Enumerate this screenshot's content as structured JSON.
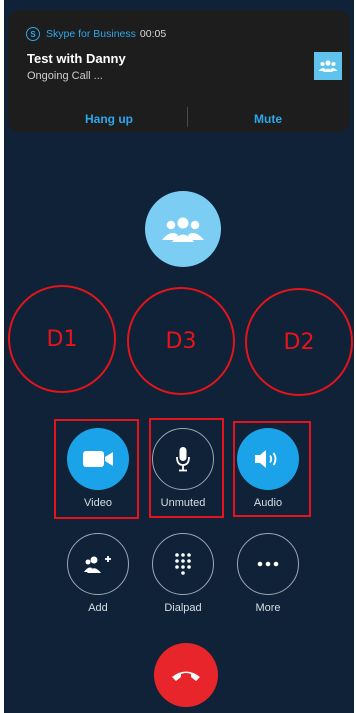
{
  "notification": {
    "app_name": "Skype for Business",
    "app_icon": "skype-icon",
    "time": "00:05",
    "title": "Test with Danny",
    "subtitle": "Ongoing Call ...",
    "actions": {
      "hangup": "Hang up",
      "mute": "Mute"
    }
  },
  "call": {
    "avatar_icon": "group-icon"
  },
  "devices": {
    "d1": "D1",
    "d3": "D3",
    "d2": "D2"
  },
  "controls": {
    "video": "Video",
    "unmuted": "Unmuted",
    "audio": "Audio",
    "add": "Add",
    "dialpad": "Dialpad",
    "more": "More"
  },
  "colors": {
    "background": "#0f2237",
    "accent": "#1aa3e8",
    "hangup": "#e8252a",
    "annotation": "#e3141b"
  }
}
